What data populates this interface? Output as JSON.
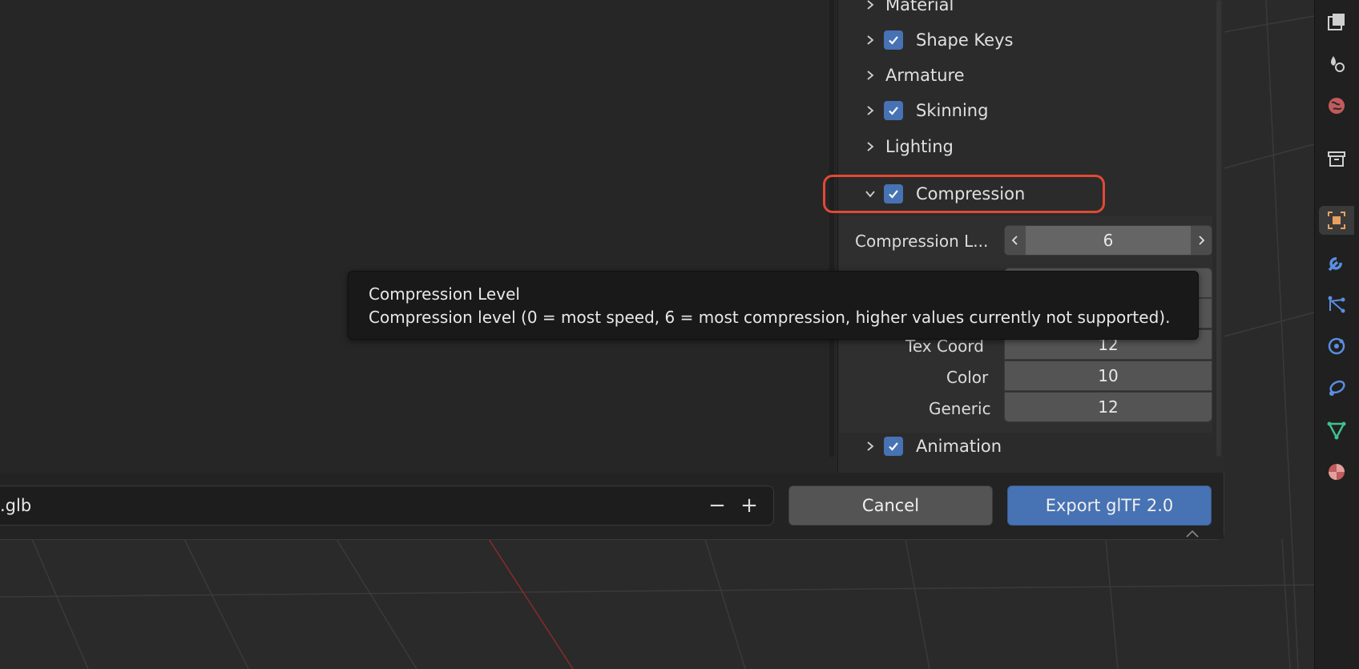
{
  "panel": {
    "rows": [
      {
        "label": "Material",
        "checkbox": false,
        "expanded": false
      },
      {
        "label": "Shape Keys",
        "checkbox": true,
        "expanded": false
      },
      {
        "label": "Armature",
        "checkbox": false,
        "expanded": false
      },
      {
        "label": "Skinning",
        "checkbox": true,
        "expanded": false
      },
      {
        "label": "Lighting",
        "checkbox": false,
        "expanded": false
      },
      {
        "label": "Compression",
        "checkbox": true,
        "expanded": true
      },
      {
        "label": "Animation",
        "checkbox": true,
        "expanded": false
      }
    ],
    "compression": {
      "level_label": "Compression L...",
      "level_value": "6",
      "fields": [
        {
          "label": "Tex Coord",
          "value": "12"
        },
        {
          "label": "Color",
          "value": "10"
        },
        {
          "label": "Generic",
          "value": "12"
        }
      ]
    }
  },
  "tooltip": {
    "title": "Compression Level",
    "description": "Compression level (0 = most speed, 6 = most compression, higher values currently not supported)."
  },
  "bottom": {
    "filename": ".glb",
    "minus": "−",
    "plus": "+",
    "cancel_label": "Cancel",
    "export_label": "Export glTF 2.0"
  },
  "properties_tabs": [
    "render-icon",
    "output-icon",
    "world-icon",
    "collection-icon",
    "object-icon",
    "modifier-icon",
    "particles-icon",
    "physics-icon",
    "constraints-icon",
    "data-icon",
    "material-icon"
  ],
  "colors": {
    "accent": "#4772b3",
    "highlight_ring": "#e04a35"
  }
}
